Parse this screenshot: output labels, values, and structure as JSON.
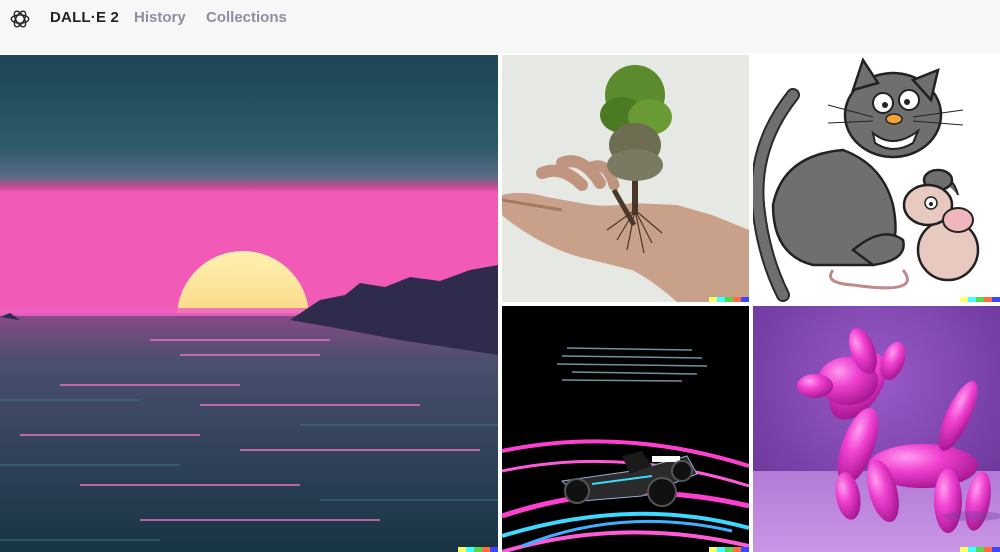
{
  "header": {
    "logo_icon": "openai-logo-icon",
    "brand": "DALL·E 2",
    "nav": [
      {
        "label": "History"
      },
      {
        "label": "Collections"
      }
    ]
  },
  "gallery": {
    "images": [
      {
        "subject": "sunset-over-sea"
      },
      {
        "subject": "tree-growing-from-hand"
      },
      {
        "subject": "cartoon-cat-and-mouse"
      },
      {
        "subject": "race-car-light-trails"
      },
      {
        "subject": "pink-balloon-dog"
      }
    ],
    "signature_colors": [
      "#ffff66",
      "#42ffff",
      "#51da4c",
      "#ff6e3c",
      "#3c46ff"
    ]
  }
}
